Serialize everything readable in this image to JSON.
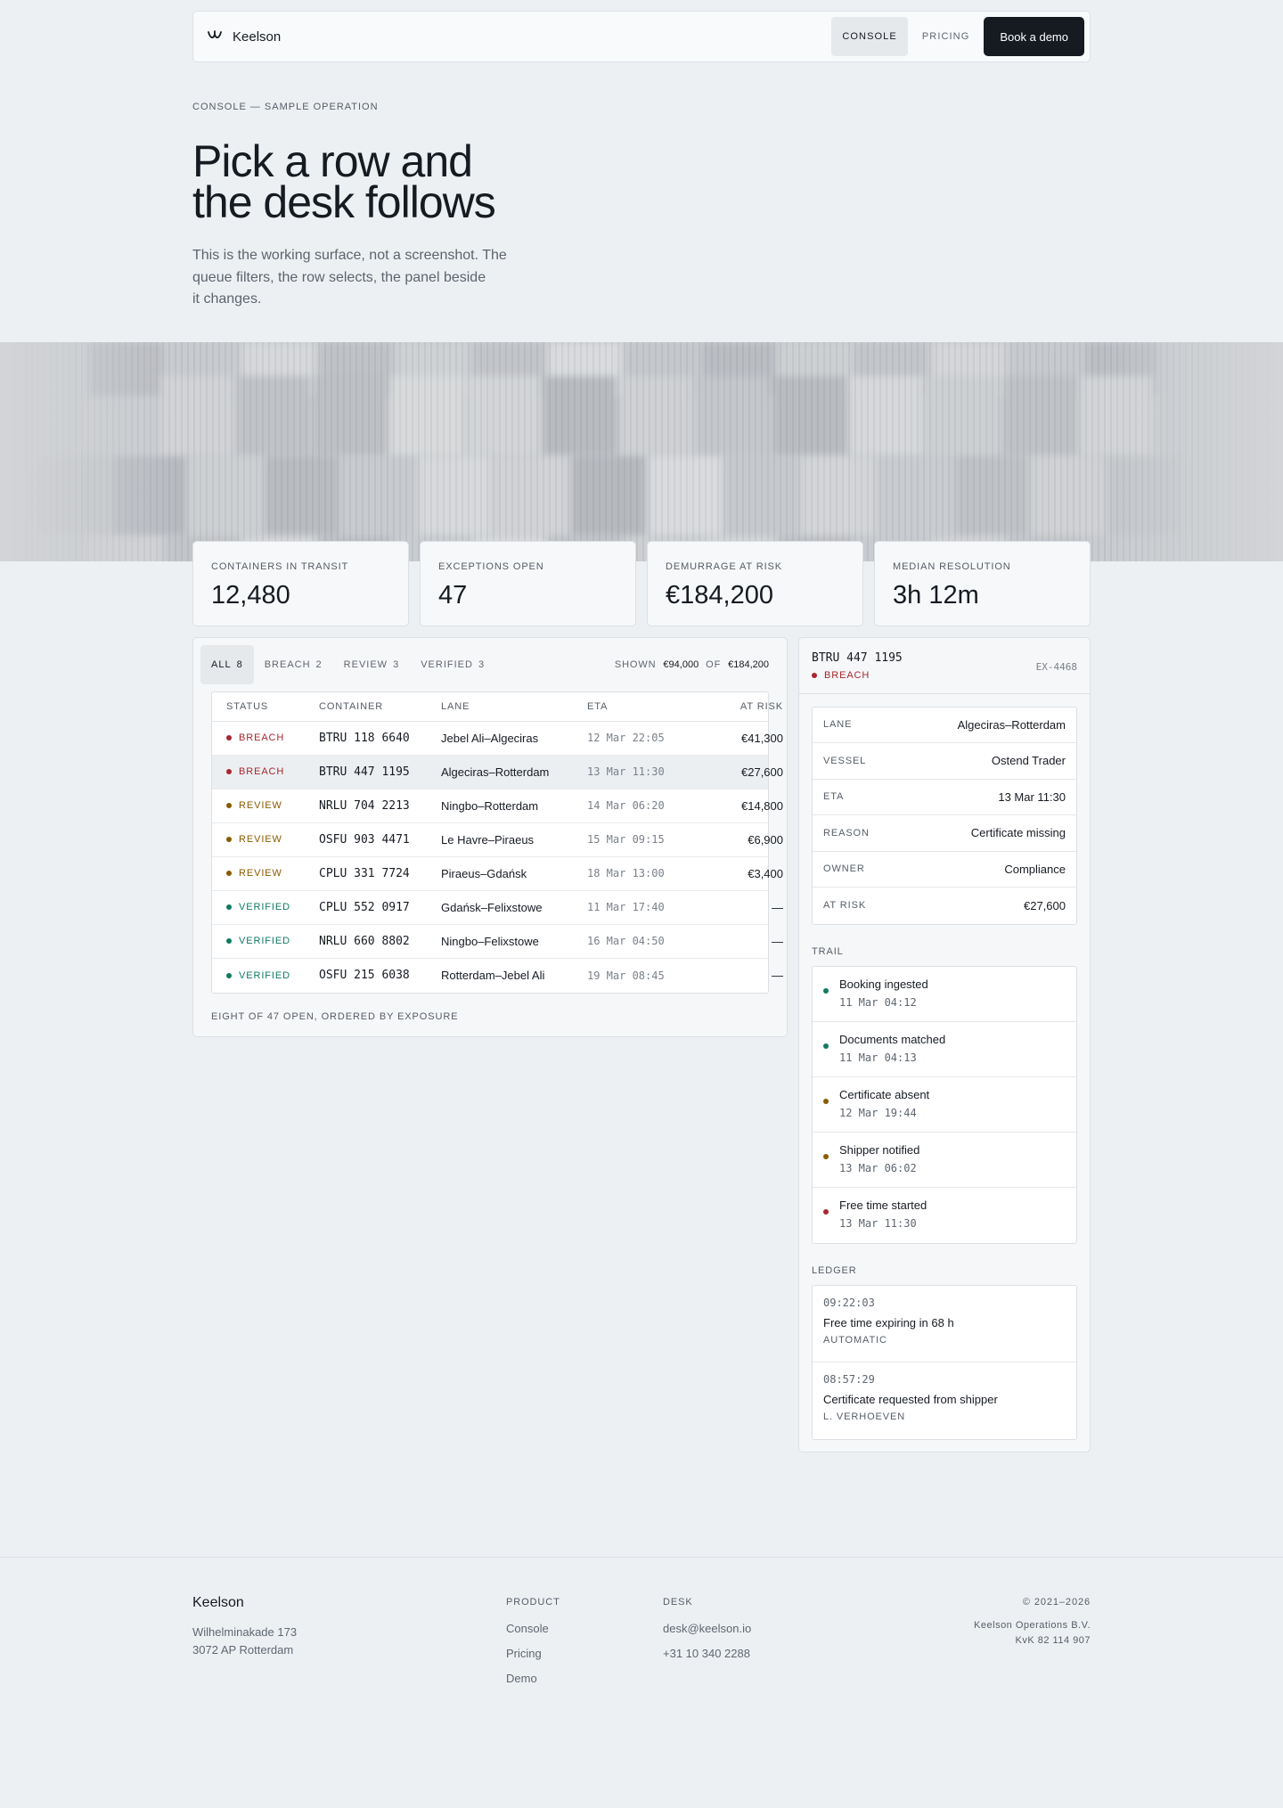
{
  "nav": {
    "brand": "Keelson",
    "links": [
      {
        "label": "CONSOLE",
        "active": true
      },
      {
        "label": "PRICING",
        "active": false
      }
    ],
    "cta": "Book a demo"
  },
  "hero": {
    "eyebrow": "CONSOLE — SAMPLE OPERATION",
    "title_line1": "Pick a row and",
    "title_line2": "the desk follows",
    "lede_line1": "This is the working surface, not a screenshot. The",
    "lede_line2": "queue filters, the row selects, the panel beside",
    "lede_line3": "it changes."
  },
  "stats": [
    {
      "label": "CONTAINERS IN TRANSIT",
      "value": "12,480"
    },
    {
      "label": "EXCEPTIONS OPEN",
      "value": "47"
    },
    {
      "label": "DEMURRAGE AT RISK",
      "value": "€184,200"
    },
    {
      "label": "MEDIAN RESOLUTION",
      "value": "3h 12m"
    }
  ],
  "queue": {
    "filters": [
      {
        "label": "ALL",
        "count": "8",
        "active": true
      },
      {
        "label": "BREACH",
        "count": "2",
        "active": false
      },
      {
        "label": "REVIEW",
        "count": "3",
        "active": false
      },
      {
        "label": "VERIFIED",
        "count": "3",
        "active": false
      }
    ],
    "shown_label": "SHOWN",
    "shown_value": "€94,000",
    "of_label": "OF",
    "total_value": "€184,200",
    "columns": [
      "STATUS",
      "CONTAINER",
      "LANE",
      "ETA",
      "AT RISK"
    ],
    "rows": [
      {
        "status": "BREACH",
        "container": "BTRU 118 6640",
        "lane": "Jebel Ali–Algeciras",
        "eta": "12 Mar 22:05",
        "risk": "€41,300",
        "selected": false
      },
      {
        "status": "BREACH",
        "container": "BTRU 447 1195",
        "lane": "Algeciras–Rotterdam",
        "eta": "13 Mar 11:30",
        "risk": "€27,600",
        "selected": true
      },
      {
        "status": "REVIEW",
        "container": "NRLU 704 2213",
        "lane": "Ningbo–Rotterdam",
        "eta": "14 Mar 06:20",
        "risk": "€14,800",
        "selected": false
      },
      {
        "status": "REVIEW",
        "container": "OSFU 903 4471",
        "lane": "Le Havre–Piraeus",
        "eta": "15 Mar 09:15",
        "risk": "€6,900",
        "selected": false
      },
      {
        "status": "REVIEW",
        "container": "CPLU 331 7724",
        "lane": "Piraeus–Gdańsk",
        "eta": "18 Mar 13:00",
        "risk": "€3,400",
        "selected": false
      },
      {
        "status": "VERIFIED",
        "container": "CPLU 552 0917",
        "lane": "Gdańsk–Felixstowe",
        "eta": "11 Mar 17:40",
        "risk": "—",
        "selected": false
      },
      {
        "status": "VERIFIED",
        "container": "NRLU 660 8802",
        "lane": "Ningbo–Felixstowe",
        "eta": "16 Mar 04:50",
        "risk": "—",
        "selected": false
      },
      {
        "status": "VERIFIED",
        "container": "OSFU 215 6038",
        "lane": "Rotterdam–Jebel Ali",
        "eta": "19 Mar 08:45",
        "risk": "—",
        "selected": false
      }
    ],
    "footnote": "EIGHT OF 47 OPEN, ORDERED BY EXPOSURE"
  },
  "status_colors": {
    "BREACH": "#a8262f",
    "REVIEW": "#8a5a00",
    "VERIFIED": "#117a63"
  },
  "detail": {
    "container": "BTRU 447 1195",
    "status": "BREACH",
    "exception_id": "EX-4468",
    "fields": [
      {
        "key": "LANE",
        "value": "Algeciras–Rotterdam"
      },
      {
        "key": "VESSEL",
        "value": "Ostend Trader"
      },
      {
        "key": "ETA",
        "value": "13 Mar 11:30"
      },
      {
        "key": "REASON",
        "value": "Certificate missing"
      },
      {
        "key": "OWNER",
        "value": "Compliance"
      },
      {
        "key": "AT RISK",
        "value": "€27,600"
      }
    ],
    "trail_heading": "TRAIL",
    "trail": [
      {
        "title": "Booking ingested",
        "time": "11 Mar 04:12",
        "tone": "VERIFIED"
      },
      {
        "title": "Documents matched",
        "time": "11 Mar 04:13",
        "tone": "VERIFIED"
      },
      {
        "title": "Certificate absent",
        "time": "12 Mar 19:44",
        "tone": "REVIEW"
      },
      {
        "title": "Shipper notified",
        "time": "13 Mar 06:02",
        "tone": "REVIEW"
      },
      {
        "title": "Free time started",
        "time": "13 Mar 11:30",
        "tone": "BREACH"
      }
    ],
    "ledger_heading": "LEDGER",
    "ledger": [
      {
        "time": "09:22:03",
        "text": "Free time expiring in 68 h",
        "by": "AUTOMATIC"
      },
      {
        "time": "08:57:29",
        "text": "Certificate requested from shipper",
        "by": "L. VERHOEVEN"
      }
    ]
  },
  "footer": {
    "brand": "Keelson",
    "address_line1": "Wilhelminakade 173",
    "address_line2": "3072 AP Rotterdam",
    "product_heading": "PRODUCT",
    "product_links": [
      "Console",
      "Pricing",
      "Demo"
    ],
    "desk_heading": "DESK",
    "desk_links": [
      "desk@keelson.io",
      "+31 10 340 2288"
    ],
    "copyright": "© 2021–2026",
    "company": "Keelson Operations B.V.",
    "kvk": "KvK 82 114 907"
  }
}
